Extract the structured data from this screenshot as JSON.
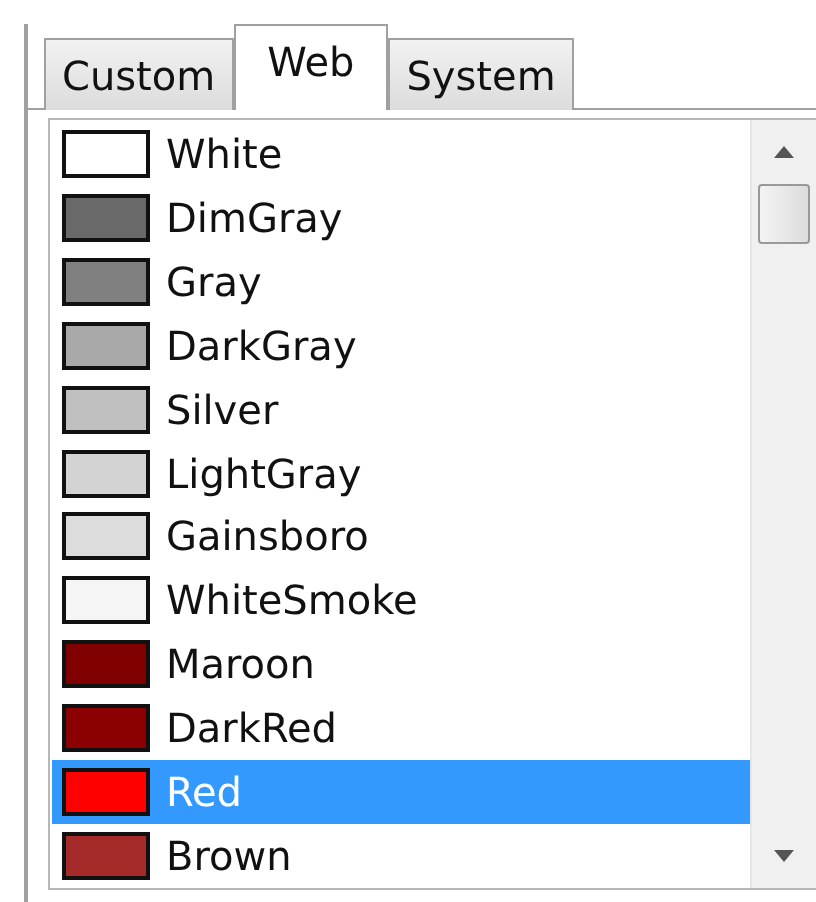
{
  "tabs": [
    {
      "label": "Custom",
      "selected": false
    },
    {
      "label": "Web",
      "selected": true
    },
    {
      "label": "System",
      "selected": false
    }
  ],
  "colors": [
    {
      "name": "White",
      "color": "#ffffff",
      "selected": false
    },
    {
      "name": "DimGray",
      "color": "#696969",
      "selected": false
    },
    {
      "name": "Gray",
      "color": "#808080",
      "selected": false
    },
    {
      "name": "DarkGray",
      "color": "#a9a9a9",
      "selected": false
    },
    {
      "name": "Silver",
      "color": "#c0c0c0",
      "selected": false
    },
    {
      "name": "LightGray",
      "color": "#d3d3d3",
      "selected": false
    },
    {
      "name": "Gainsboro",
      "color": "#dcdcdc",
      "selected": false
    },
    {
      "name": "WhiteSmoke",
      "color": "#f5f5f5",
      "selected": false
    },
    {
      "name": "Maroon",
      "color": "#800000",
      "selected": false
    },
    {
      "name": "DarkRed",
      "color": "#8b0000",
      "selected": false
    },
    {
      "name": "Red",
      "color": "#ff0000",
      "selected": true
    },
    {
      "name": "Brown",
      "color": "#a52a2a",
      "selected": false
    }
  ]
}
